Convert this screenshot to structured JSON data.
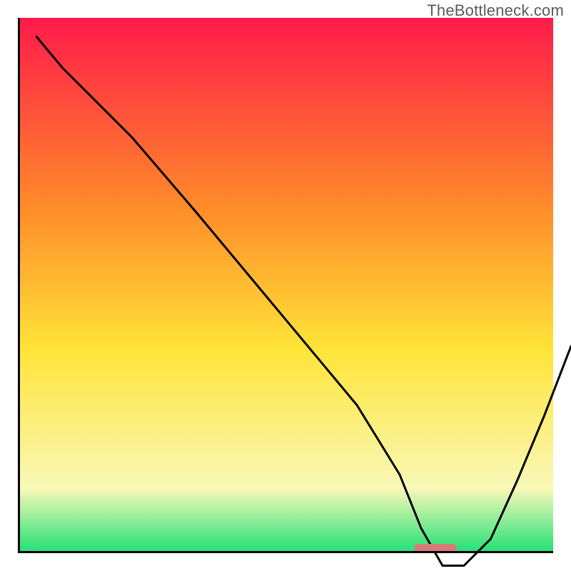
{
  "watermark": "TheBottleneck.com",
  "colors": {
    "gradient_top": "#ff1a4a",
    "gradient_mid1": "#ff8a2a",
    "gradient_mid2": "#ffe438",
    "gradient_soft": "#f8f8b8",
    "gradient_bottom": "#1ee076",
    "curve": "#000000",
    "marker": "#d97a7a",
    "axis": "#000000"
  },
  "chart_data": {
    "type": "line",
    "title": "",
    "xlabel": "",
    "ylabel": "",
    "xlim": [
      0,
      100
    ],
    "ylim": [
      0,
      100
    ],
    "x": [
      0,
      5,
      18,
      30,
      40,
      50,
      60,
      68,
      72,
      76,
      80,
      85,
      90,
      95,
      100
    ],
    "values": [
      100,
      94,
      81,
      67,
      55,
      43,
      31,
      18,
      8,
      1,
      1,
      6,
      17,
      29,
      42
    ],
    "annotations": [
      {
        "kind": "min-marker",
        "x_start": 74,
        "x_end": 82,
        "y": 1
      }
    ]
  }
}
